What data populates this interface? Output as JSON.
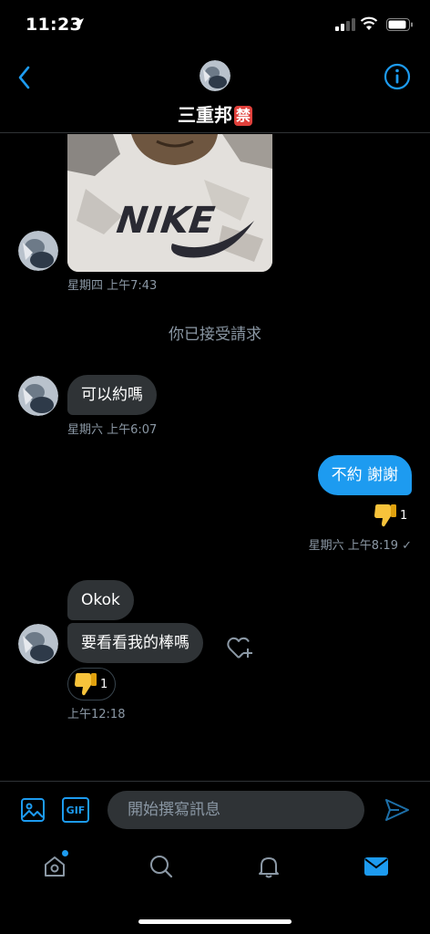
{
  "status_bar": {
    "time": "11:23"
  },
  "header": {
    "title": "三重邦",
    "badge": "禁"
  },
  "messages": {
    "photo_time": "星期四 上午7:43",
    "system_notice": "你已接受請求",
    "msg1": {
      "text": "可以約嗎",
      "time": "星期六 上午6:07"
    },
    "msg2": {
      "text": "不約 謝謝",
      "reaction_count": "1",
      "time": "星期六 上午8:19 ✓"
    },
    "msg3": {
      "text": "Okok"
    },
    "msg4": {
      "text": "要看看我的棒嗎",
      "reaction_count": "1",
      "time": "上午12:18"
    }
  },
  "composer": {
    "placeholder": "開始撰寫訊息",
    "gif_label": "GIF"
  },
  "colors": {
    "accent": "#1d9bf0",
    "bubble_in": "#2f3336",
    "muted": "#8b98a5",
    "ban_badge": "#e0403b"
  },
  "icons": [
    "back-icon",
    "info-icon",
    "image-icon",
    "gif-icon",
    "send-icon",
    "home-icon",
    "search-icon",
    "bell-icon",
    "mail-icon",
    "thumbs-down-icon",
    "heart-add-icon"
  ]
}
